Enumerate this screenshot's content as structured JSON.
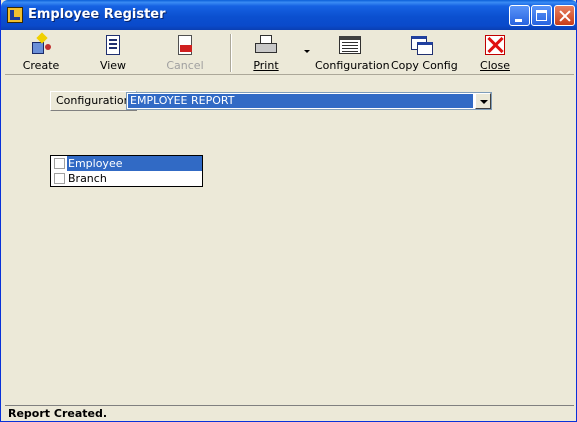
{
  "window": {
    "title": "Employee Register"
  },
  "toolbar": {
    "create_label": "Create",
    "view_label": "View",
    "cancel_label": "Cancel",
    "print_label": "Print",
    "configuration_label": "Configuration",
    "copy_config_label": "Copy Config",
    "close_label": "Close"
  },
  "config": {
    "label": "Configuration",
    "selected": "EMPLOYEE REPORT"
  },
  "checklist": {
    "items": [
      {
        "label": "Employee",
        "checked": false,
        "selected": true
      },
      {
        "label": "Branch",
        "checked": false,
        "selected": false
      }
    ]
  },
  "status": {
    "text": "Report Created."
  },
  "colors": {
    "selection": "#316ac5",
    "window_bg": "#ece9d8",
    "titlebar": "#0a4acb"
  },
  "icons": {
    "create": "create-report-icon",
    "view": "view-report-icon",
    "cancel": "cancel-report-icon",
    "print": "printer-icon",
    "configuration": "configuration-icon",
    "copy_config": "copy-config-icon",
    "close": "close-x-icon"
  }
}
